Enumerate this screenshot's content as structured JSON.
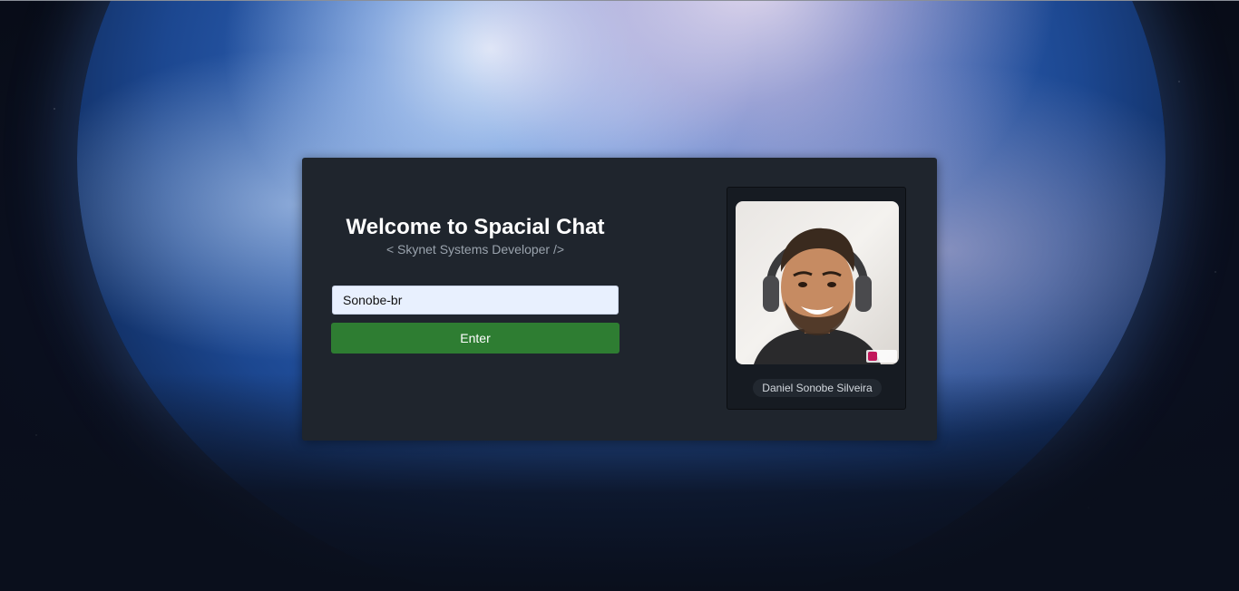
{
  "app": {
    "title": "Welcome to Spacial Chat",
    "subtitle": "< Skynet Systems Developer />"
  },
  "login": {
    "username_value": "Sonobe-br",
    "enter_label": "Enter"
  },
  "profile": {
    "name": "Daniel Sonobe Silveira",
    "watermark": "voilà"
  },
  "colors": {
    "card_bg": "#1f252d",
    "enter_button": "#2e7d32",
    "input_bg": "#e8f0fe"
  }
}
